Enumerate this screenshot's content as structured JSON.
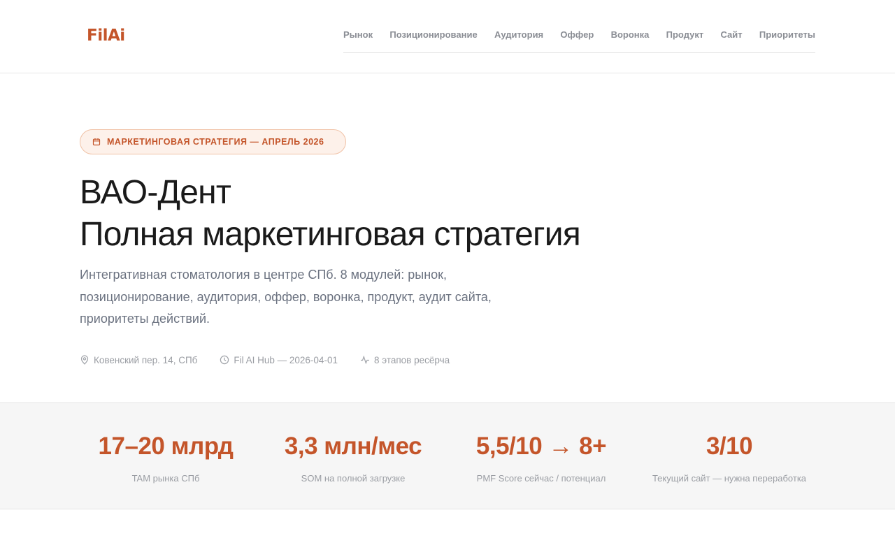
{
  "brand": {
    "logo_text": "FilAi",
    "accent_color": "#c4552a"
  },
  "nav": {
    "items": [
      {
        "label": "Рынок"
      },
      {
        "label": "Позиционирование"
      },
      {
        "label": "Аудитория"
      },
      {
        "label": "Оффер"
      },
      {
        "label": "Воронка"
      },
      {
        "label": "Продукт"
      },
      {
        "label": "Сайт"
      },
      {
        "label": "Приоритеты"
      }
    ]
  },
  "hero": {
    "badge": {
      "icon": "calendar-icon",
      "text": "МАРКЕТИНГОВАЯ СТРАТЕГИЯ — АПРЕЛЬ 2026"
    },
    "title_line1": "ВАО-Дент",
    "title_line2": "Полная маркетинговая стратегия",
    "subtitle": "Интегративная стоматология в центре СПб. 8 модулей: рынок, позиционирование, аудитория, оффер, воронка, продукт, аудит сайта, приоритеты действий.",
    "meta": [
      {
        "icon": "map-pin-icon",
        "text": "Ковенский пер. 14, СПб"
      },
      {
        "icon": "clock-icon",
        "text": "Fil AI Hub — 2026-04-01"
      },
      {
        "icon": "activity-icon",
        "text": "8 этапов ресёрча"
      }
    ]
  },
  "stats": [
    {
      "value": "17–20 млрд",
      "label": "TAM рынка СПб"
    },
    {
      "value": "3,3 млн/мес",
      "label": "SOM на полной загрузке"
    },
    {
      "value": "5,5/10 → 8+",
      "label": "PMF Score сейчас / потенциал"
    },
    {
      "value": "3/10",
      "label": "Текущий сайт — нужна переработка"
    }
  ]
}
